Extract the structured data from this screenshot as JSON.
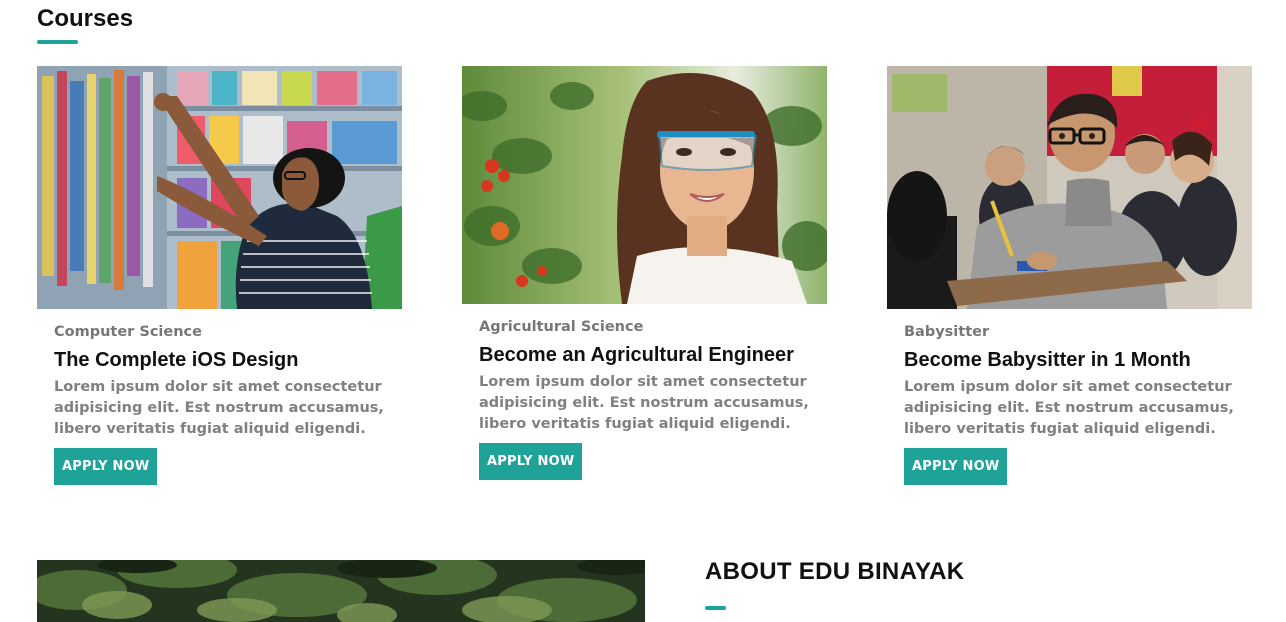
{
  "courses_section": {
    "title": "Courses"
  },
  "courses": [
    {
      "category": "Computer Science",
      "title": "The Complete iOS Design",
      "description": "Lorem ipsum dolor sit amet consectetur adipisicing elit. Est nostrum accusamus, libero veritatis fugiat aliquid eligendi.",
      "button_label": "APPLY NOW",
      "image_subject": "man-browsing-bookstore-shelves"
    },
    {
      "category": "Agricultural Science",
      "title": "Become an Agricultural Engineer",
      "description": "Lorem ipsum dolor sit amet consectetur adipisicing elit. Est nostrum accusamus, libero veritatis fugiat aliquid eligendi.",
      "button_label": "APPLY NOW",
      "image_subject": "woman-in-safety-glasses-greenhouse"
    },
    {
      "category": "Babysitter",
      "title": "Become Babysitter in 1 Month",
      "description": "Lorem ipsum dolor sit amet consectetur adipisicing elit. Est nostrum accusamus, libero veritatis fugiat aliquid eligendi.",
      "button_label": "APPLY NOW",
      "image_subject": "boy-with-glasses-in-classroom"
    }
  ],
  "about_section": {
    "title": "ABOUT EDU BINAYAK"
  },
  "colors": {
    "accent": "#1fa398",
    "heading": "#111111",
    "category_text": "#777777",
    "body_text": "#808080"
  }
}
